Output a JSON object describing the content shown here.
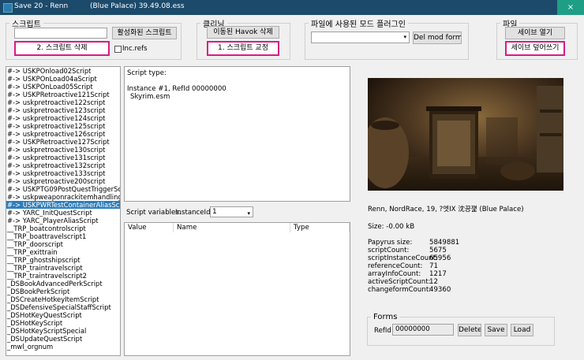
{
  "window": {
    "title": "Save 20 - Renn",
    "subtitle": "(Blue Palace)  39.49.08.ess",
    "close_label": "×"
  },
  "script_group": {
    "legend": "스크립트",
    "active_scripts_button": "활성화된 스크립트",
    "delete_scripts_button": "2. 스크립트 삭제",
    "inc_refs_label": "Inc.refs",
    "filter_value": ""
  },
  "cleaning_group": {
    "legend": "클리닝",
    "remove_havok_button": "이동된 Havok 삭제",
    "fix_scripts_button": "1. 스크립트 교정"
  },
  "plugins_group": {
    "legend": "파일에 사용된 모드 플러그인",
    "selected_plugin": "",
    "del_mod_forms_button": "Del mod forms"
  },
  "file_group": {
    "legend": "파일",
    "open_save_button": "세이브 열기",
    "overwrite_save_button": "세이브 덮어쓰기"
  },
  "script_list": {
    "selected_index": 17,
    "items": [
      "#-> USKPOnload02Script",
      "#-> USKPOnLoad04aScript",
      "#-> USKPOnLoad05Script",
      "#-> USKPRetroactive121Script",
      "#-> uskpretroactive122script",
      "#-> uskpretroactive123script",
      "#-> uskpretroactive124script",
      "#-> uskpretroactive125script",
      "#-> uskpretroactive126script",
      "#-> USKPRetroactive127Script",
      "#-> uskpretroactive130script",
      "#-> uskpretroactive131script",
      "#-> uskpretroactive132script",
      "#-> uskpretroactive133script",
      "#-> uskpretroactive200script",
      "#-> USKPTG09PostQuestTriggerSc",
      "#-> uskpweaponrackitemhandlingsc",
      "#-> USKPWRTestContainerAliasSc",
      "#-> YARC_InitQuestScript",
      "#-> YARC_PlayerAliasScript",
      "__TRP_boatcontrolscript",
      "__TRP_boattravelscript1",
      "__TRP_doorscript",
      "__TRP_exittrain",
      "__TRP_ghostshipscript",
      "__TRP_traintravelscript",
      "__TRP_traintravelscript2",
      "_DSBookAdvancedPerkScript",
      "_DSBookPerkScript",
      "_DSCreateHotkeyItemScript",
      "_DSDefensiveSpecialStaffScript",
      "_DSHotKeyQuestScript",
      "_DSHotKeyScript",
      "_DSHotKeyScriptSpecial",
      "_DSUpdateQuestScript",
      "_mwl_orgnum"
    ]
  },
  "script_info": {
    "type_label": "Script type:",
    "line1": "Instance #1, RefId 00000000",
    "line2": "Skyrim.esm"
  },
  "variables": {
    "label": "Script variables.",
    "instance_label": "InstanceId:",
    "instance_value": "1",
    "columns": [
      "Value",
      "Name",
      "Type"
    ]
  },
  "save_info": {
    "character": "Renn, NordRace, 19, ?엣IX 沈끙쟱 (Blue Palace)",
    "size": "Size: -0.00 kB",
    "stats": [
      {
        "key": "Papyrus size:",
        "value": "5849881"
      },
      {
        "key": "scriptCount:",
        "value": "5675"
      },
      {
        "key": "scriptInstanceCount:",
        "value": "65956"
      },
      {
        "key": "referenceCount:",
        "value": "71"
      },
      {
        "key": "arrayInfoCount:",
        "value": "1217"
      },
      {
        "key": "activeScriptCount:",
        "value": "12"
      },
      {
        "key": "changeformCount:",
        "value": "49360"
      }
    ]
  },
  "forms": {
    "legend": "Forms",
    "refid_label": "RefId",
    "refid_value": "00000000",
    "delete_button": "Delete",
    "save_button": "Save",
    "load_button": "Load"
  },
  "colors": {
    "titlebar": "#1c4a6b",
    "close": "#1f9e86",
    "highlight_border": "#d81b86",
    "selection": "#2f7db9"
  }
}
